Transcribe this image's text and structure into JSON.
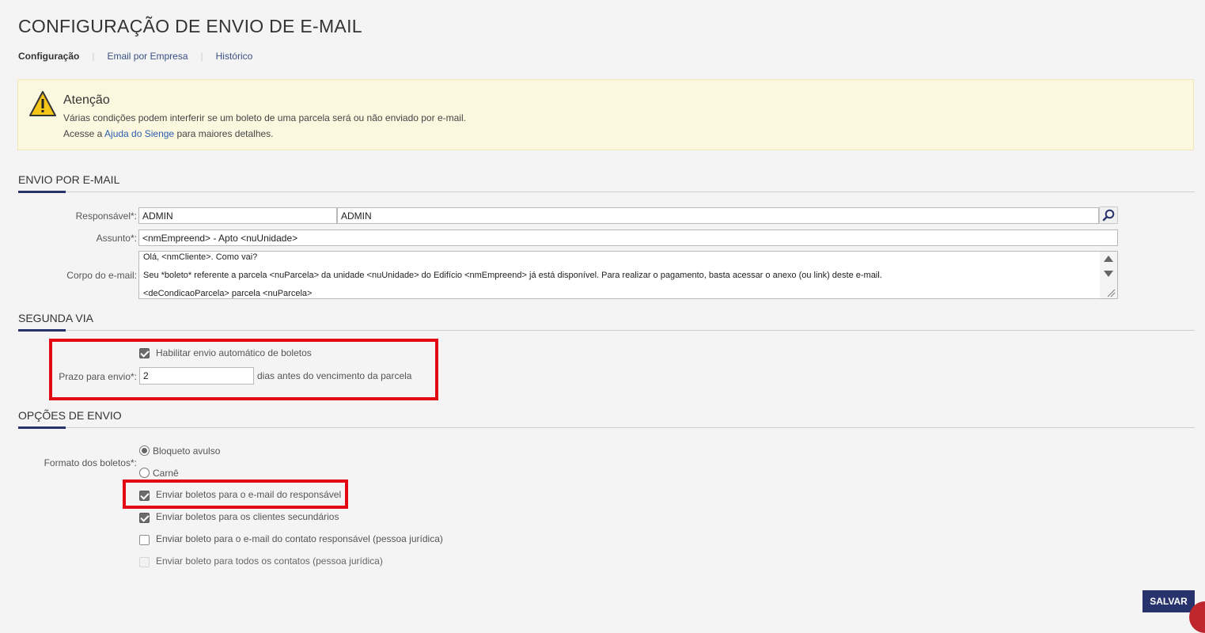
{
  "page": {
    "title": "CONFIGURAÇÃO DE ENVIO DE E-MAIL",
    "tabs": [
      {
        "label": "Configuração",
        "active": true
      },
      {
        "label": "Email por Empresa",
        "active": false
      },
      {
        "label": "Histórico",
        "active": false
      }
    ]
  },
  "alert": {
    "icon": "warning-icon",
    "title": "Atenção",
    "line1": "Várias condições podem interferir se um boleto de uma parcela será ou não enviado por e-mail.",
    "line2_prefix": "Acesse a ",
    "line2_link": "Ajuda do Sienge",
    "line2_suffix": " para maiores detalhes."
  },
  "envio_email": {
    "section_title": "ENVIO POR E-MAIL",
    "responsavel_label": "Responsável*:",
    "responsavel_code": "ADMIN",
    "responsavel_name": "ADMIN",
    "assunto_label": "Assunto*:",
    "assunto_value": "<nmEmpreend> - Apto <nuUnidade>",
    "corpo_label": "Corpo do e-mail:",
    "corpo_lines": [
      "Olá, <nmCliente>. Como vai?",
      "Seu *boleto*  referente a parcela <nuParcela> da unidade <nuUnidade> do Edifício <nmEmpreend> já está disponível. Para realizar o pagamento, basta acessar o anexo (ou link) deste e-mail.",
      "<deCondicaoParcela> parcela <nuParcela>"
    ]
  },
  "segunda_via": {
    "section_title": "SEGUNDA VIA",
    "habilitar_label": "Habilitar envio automático de boletos",
    "habilitar_checked": true,
    "prazo_label": "Prazo para envio*:",
    "prazo_value": "2",
    "prazo_suffix": "dias antes do vencimento da parcela"
  },
  "opcoes_envio": {
    "section_title": "OPÇÕES DE ENVIO",
    "formato_label": "Formato dos boletos*:",
    "formatos": [
      {
        "label": "Bloqueto avulso",
        "selected": true
      },
      {
        "label": "Carnê",
        "selected": false
      }
    ],
    "checkboxes": [
      {
        "label": "Enviar boletos para o e-mail do responsável",
        "checked": true,
        "disabled": false
      },
      {
        "label": "Enviar boletos para os clientes secundários",
        "checked": true,
        "disabled": false
      },
      {
        "label": "Enviar boleto para o e-mail do contato responsável (pessoa jurídica)",
        "checked": false,
        "disabled": false
      },
      {
        "label": "Enviar boleto para todos os contatos (pessoa jurídica)",
        "checked": false,
        "disabled": true
      }
    ]
  },
  "footer": {
    "save_label": "SALVAR"
  },
  "colors": {
    "primary": "#28336e",
    "highlight": "#e30613",
    "alert_bg": "#fcf8e0",
    "link": "#2a5db0"
  }
}
